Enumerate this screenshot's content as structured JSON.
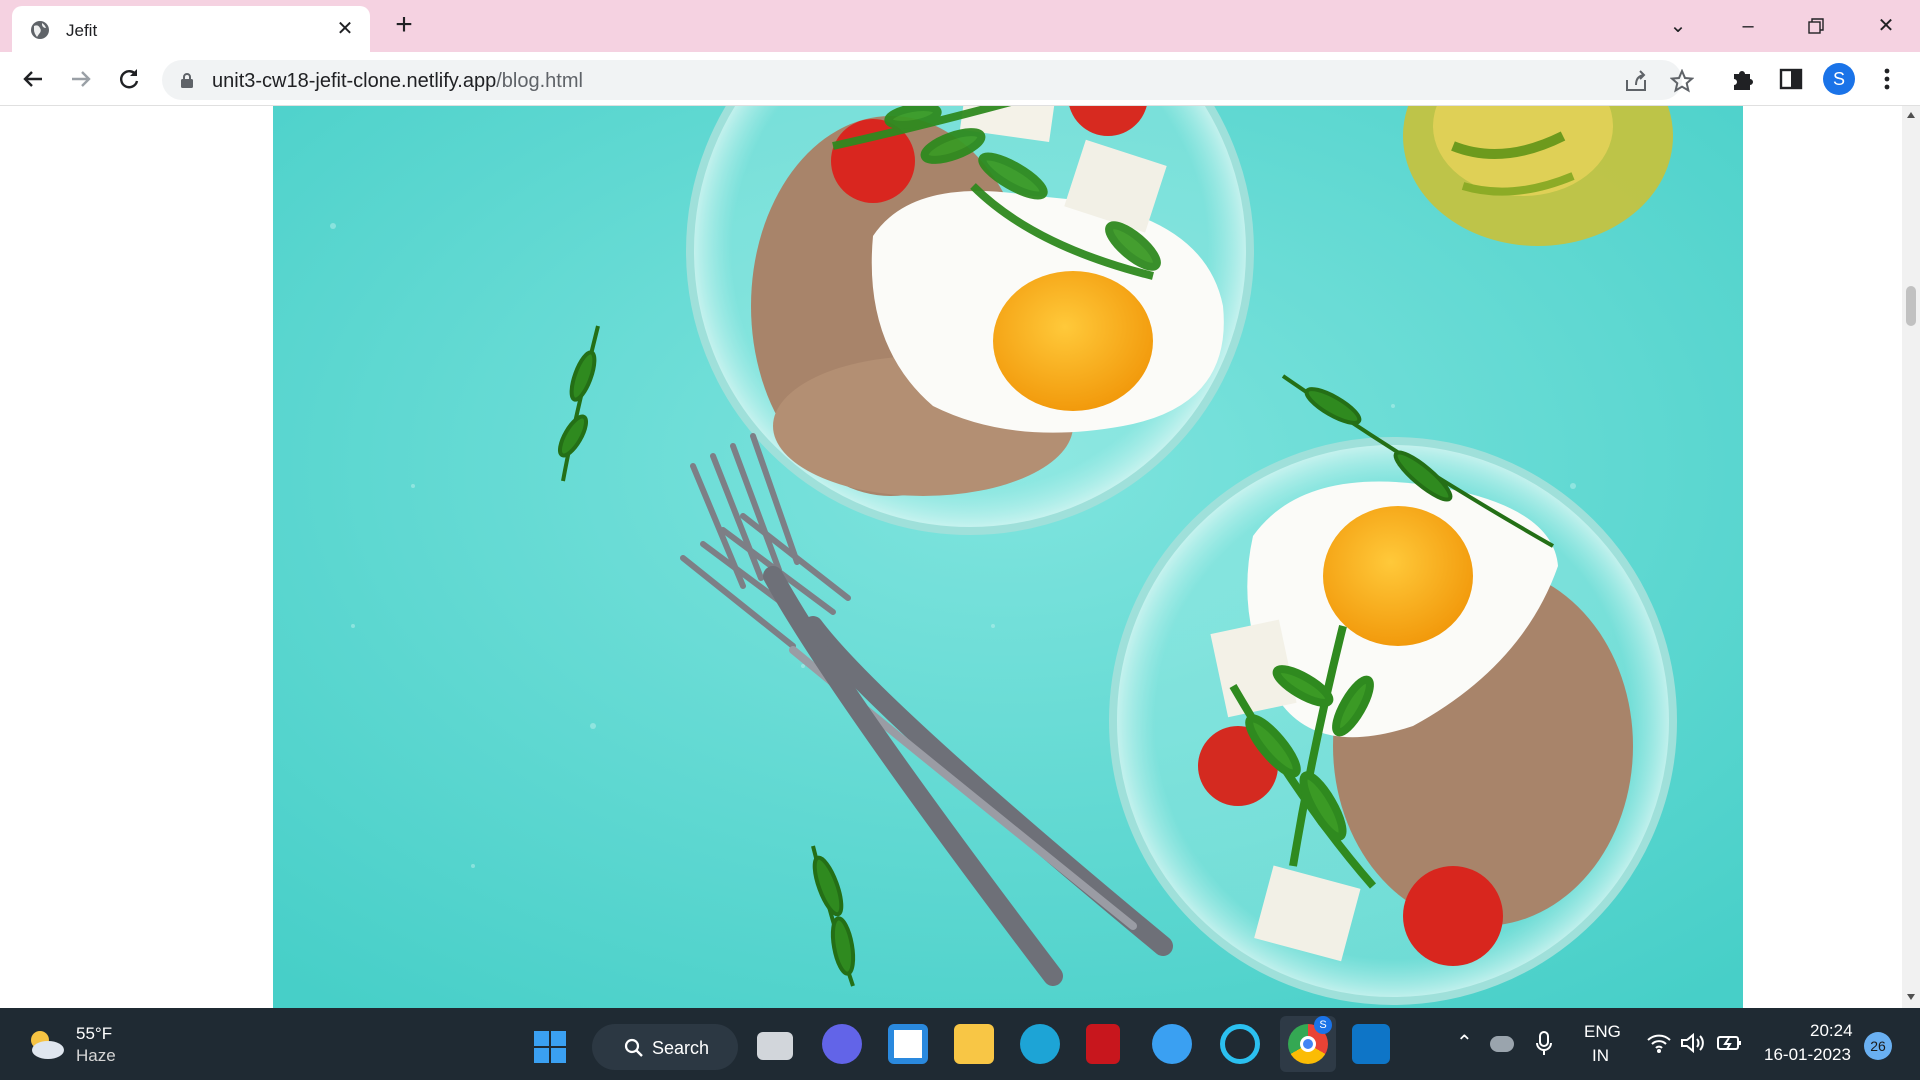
{
  "browser": {
    "tab_title": "Jefit",
    "url_host": "unit3-cw18-jefit-clone.netlify.app",
    "url_path": "/blog.html",
    "profile_initial": "S",
    "colors": {
      "titlebar": "#f5d2e1",
      "accent": "#1a73e8"
    }
  },
  "hero_image": {
    "description_icons": [
      "plate-icon",
      "egg-icon",
      "fork-icon",
      "arugula-icon",
      "tomato-icon",
      "oil-jar-icon"
    ]
  },
  "taskbar": {
    "weather_temp": "55°F",
    "weather_desc": "Haze",
    "search_label": "Search",
    "lang_top": "ENG",
    "lang_bottom": "IN",
    "time": "20:24",
    "date": "16-01-2023",
    "notification_count": "26",
    "chrome_badge": "S"
  }
}
